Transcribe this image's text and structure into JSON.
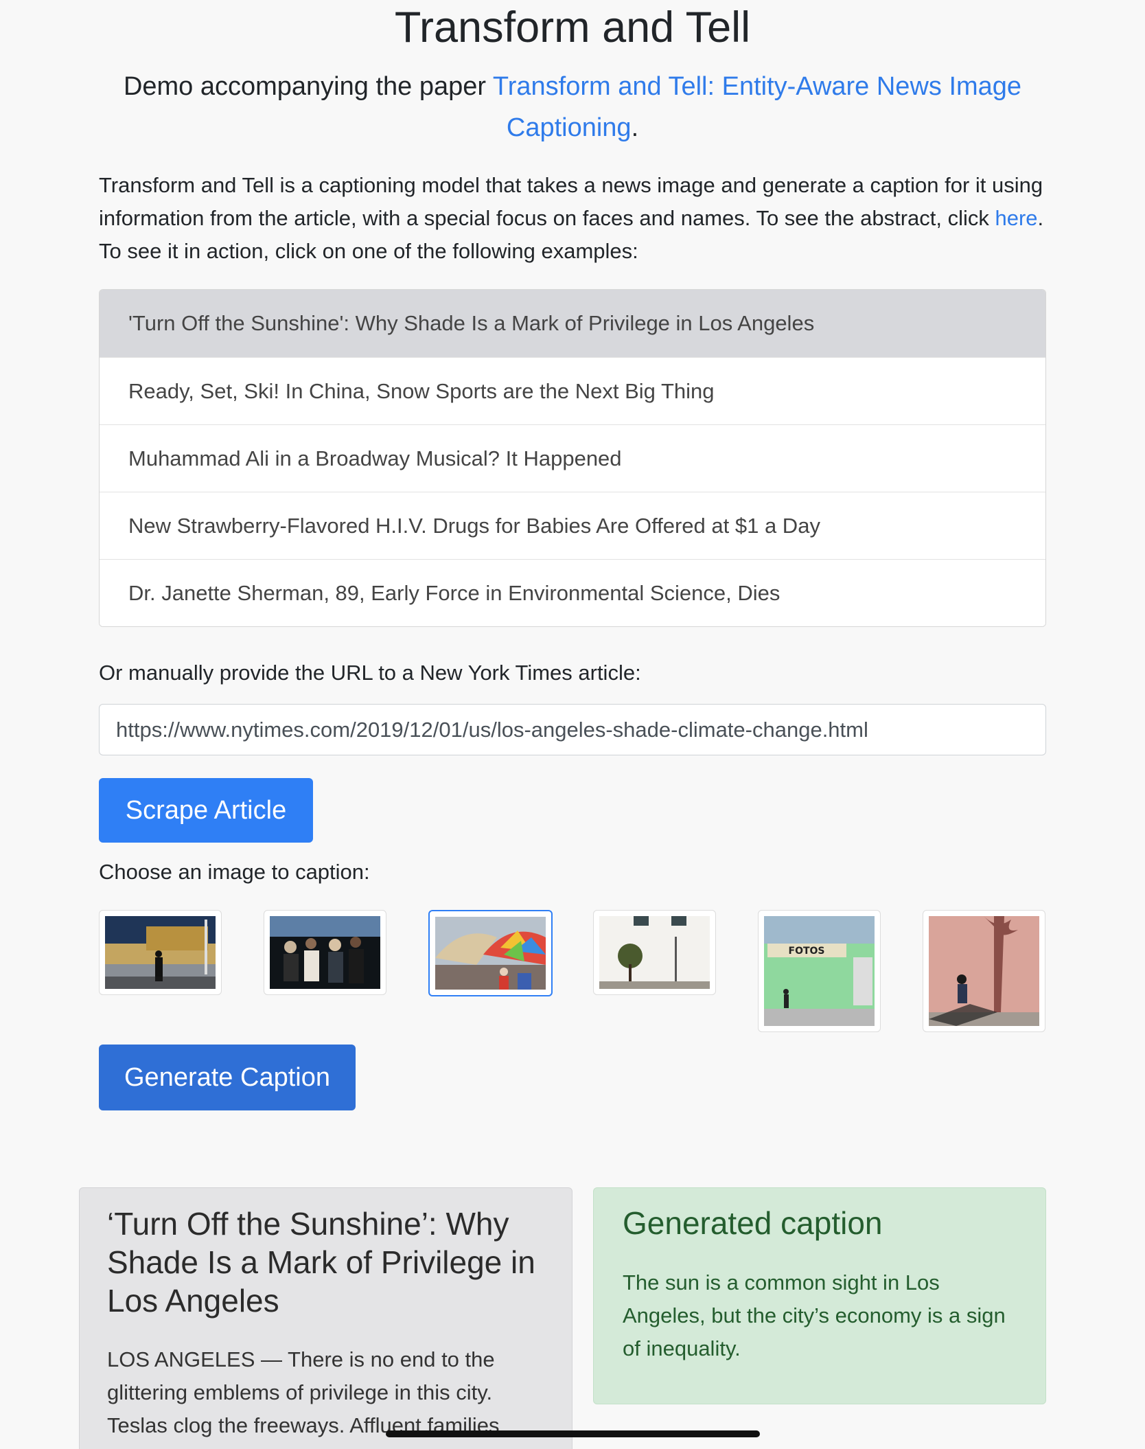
{
  "header": {
    "title": "Transform and Tell",
    "subtitle_prefix": "Demo accompanying the paper ",
    "paper_link": "Transform and Tell: Entity-Aware News Image Captioning",
    "subtitle_suffix": "."
  },
  "intro": {
    "text_before": "Transform and Tell is a captioning model that takes a news image and generate a caption for it using information from the article, with a special focus on faces and names. To see the abstract, click ",
    "link": "here",
    "text_after": ". To see it in action, click on one of the following examples:"
  },
  "examples": [
    {
      "label": "'Turn Off the Sunshine': Why Shade Is a Mark of Privilege in Los Angeles",
      "active": true
    },
    {
      "label": "Ready, Set, Ski! In China, Snow Sports are the Next Big Thing",
      "active": false
    },
    {
      "label": "Muhammad Ali in a Broadway Musical? It Happened",
      "active": false
    },
    {
      "label": "New Strawberry-Flavored H.I.V. Drugs for Babies Are Offered at $1 a Day",
      "active": false
    },
    {
      "label": "Dr. Janette Sherman, 89, Early Force in Environmental Science, Dies",
      "active": false
    }
  ],
  "url_form": {
    "label": "Or manually provide the URL to a New York Times article:",
    "value": "https://www.nytimes.com/2019/12/01/us/los-angeles-shade-climate-change.html",
    "scrape_button": "Scrape Article"
  },
  "images": {
    "label": "Choose an image to caption:",
    "selected_index": 2,
    "sign_text": "FOTOS",
    "generate_button": "Generate Caption"
  },
  "article": {
    "title": "‘Turn Off the Sunshine’: Why Shade Is a Mark of Privilege in Los Angeles",
    "body": "LOS ANGELES — There is no end to the glittering emblems of privilege in this city. Teslas clog the freeways. Affluent families"
  },
  "caption": {
    "heading": "Generated caption",
    "text": "The sun is a common sight in Los Angeles, but the city’s economy is a sign of inequality."
  }
}
